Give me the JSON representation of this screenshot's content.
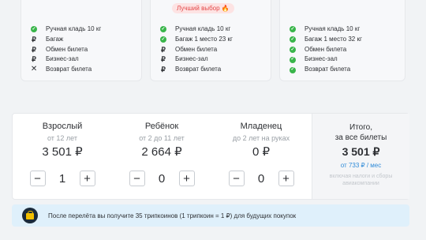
{
  "fares": [
    {
      "features": [
        {
          "icon": "check-icon",
          "label": "Ручная кладь 10 кг"
        },
        {
          "icon": "ruble-icon",
          "label": "Багаж"
        },
        {
          "icon": "ruble-icon",
          "label": "Обмен билета"
        },
        {
          "icon": "ruble-icon",
          "label": "Бизнес-зал"
        },
        {
          "icon": "cross-icon",
          "label": "Возврат билета"
        }
      ]
    },
    {
      "badge": "Лучший выбор 🔥",
      "features": [
        {
          "icon": "check-icon",
          "label": "Ручная кладь 10 кг"
        },
        {
          "icon": "check-icon",
          "label": "Багаж 1 место 23 кг"
        },
        {
          "icon": "ruble-icon",
          "label": "Обмен билета"
        },
        {
          "icon": "ruble-icon",
          "label": "Бизнес-зал"
        },
        {
          "icon": "ruble-icon",
          "label": "Возврат билета"
        }
      ]
    },
    {
      "features": [
        {
          "icon": "check-icon",
          "label": "Ручная кладь 10 кг"
        },
        {
          "icon": "check-icon",
          "label": "Багаж 1 место 32 кг"
        },
        {
          "icon": "check-icon",
          "label": "Обмен билета"
        },
        {
          "icon": "check-icon",
          "label": "Бизнес-зал"
        },
        {
          "icon": "check-icon",
          "label": "Возврат билета"
        }
      ]
    }
  ],
  "passengers": [
    {
      "title": "Взрослый",
      "sub": "от 12 лет",
      "price": "3 501 ₽",
      "count": "1"
    },
    {
      "title": "Ребёнок",
      "sub": "от 2 до 11 лет",
      "price": "2 664 ₽",
      "count": "0"
    },
    {
      "title": "Младенец",
      "sub": "до 2 лет на руках",
      "price": "0 ₽",
      "count": "0"
    }
  ],
  "stepper": {
    "minus": "−",
    "plus": "+"
  },
  "total": {
    "line1": "Итого,",
    "line2": "за все билеты",
    "amount": "3 501 ₽",
    "monthly": "от 733 ₽ / мес",
    "note": "включая налоги и сборы авиакомпании"
  },
  "banner": {
    "text": "После перелёта вы получите 35 трипкоинов (1 трипкоин = 1 ₽) для будущих покупок"
  }
}
